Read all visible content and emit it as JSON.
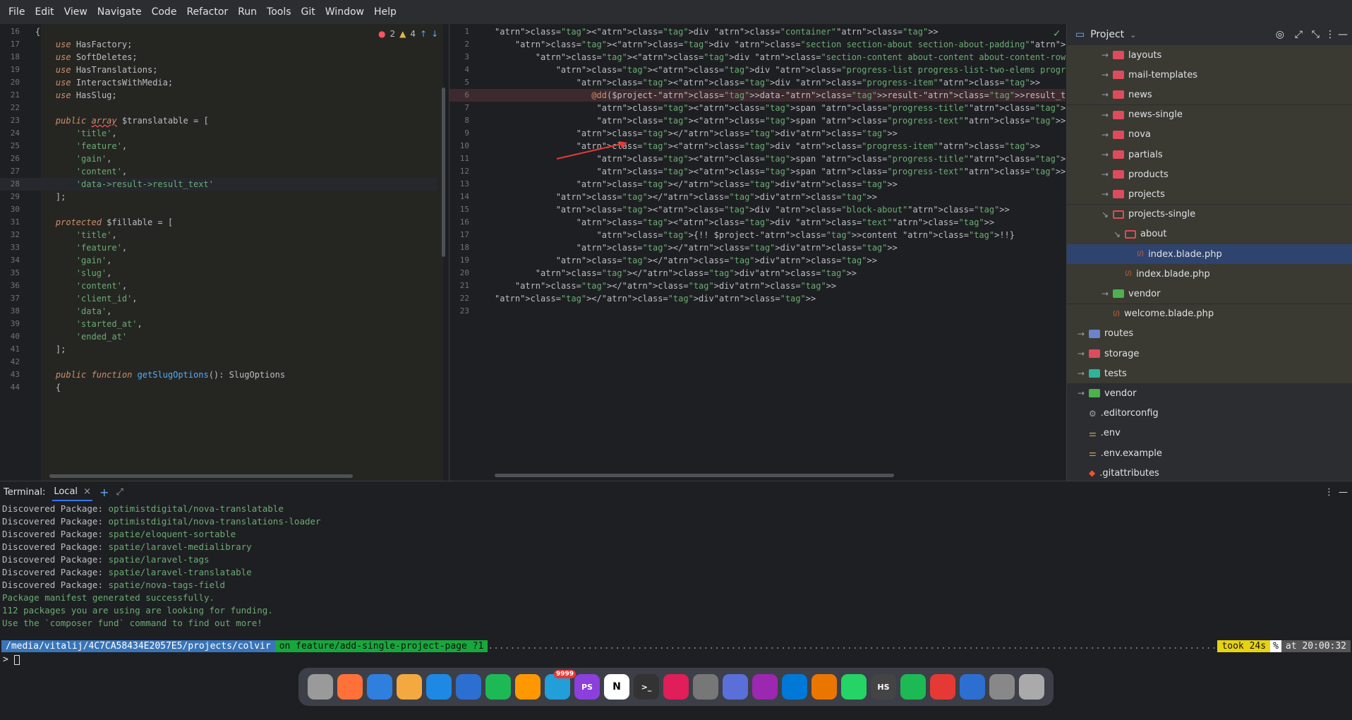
{
  "menu": [
    "File",
    "Edit",
    "View",
    "Navigate",
    "Code",
    "Refactor",
    "Run",
    "Tools",
    "Git",
    "Window",
    "Help"
  ],
  "left_editor": {
    "inspection": {
      "errors": "2",
      "warnings": "4"
    },
    "lines": [
      {
        "n": "16",
        "t": "{"
      },
      {
        "n": "17",
        "t": "    use HasFactory;"
      },
      {
        "n": "18",
        "t": "    use SoftDeletes;"
      },
      {
        "n": "19",
        "t": "    use HasTranslations;"
      },
      {
        "n": "20",
        "t": "    use InteractsWithMedia;"
      },
      {
        "n": "21",
        "t": "    use HasSlug;"
      },
      {
        "n": "22",
        "t": ""
      },
      {
        "n": "23",
        "t": "    public array $translatable = ["
      },
      {
        "n": "24",
        "t": "        'title',"
      },
      {
        "n": "25",
        "t": "        'feature',"
      },
      {
        "n": "26",
        "t": "        'gain',"
      },
      {
        "n": "27",
        "t": "        'content',"
      },
      {
        "n": "28",
        "t": "        'data->result->result_text'"
      },
      {
        "n": "29",
        "t": "    ];"
      },
      {
        "n": "30",
        "t": ""
      },
      {
        "n": "31",
        "t": "    protected $fillable = ["
      },
      {
        "n": "32",
        "t": "        'title',"
      },
      {
        "n": "33",
        "t": "        'feature',"
      },
      {
        "n": "34",
        "t": "        'gain',"
      },
      {
        "n": "35",
        "t": "        'slug',"
      },
      {
        "n": "36",
        "t": "        'content',"
      },
      {
        "n": "37",
        "t": "        'client_id',"
      },
      {
        "n": "38",
        "t": "        'data',"
      },
      {
        "n": "39",
        "t": "        'started_at',"
      },
      {
        "n": "40",
        "t": "        'ended_at'"
      },
      {
        "n": "41",
        "t": "    ];"
      },
      {
        "n": "42",
        "t": ""
      },
      {
        "n": "43",
        "t": "    public function getSlugOptions(): SlugOptions"
      },
      {
        "n": "44",
        "t": "    {"
      }
    ]
  },
  "right_editor": {
    "lines": [
      {
        "n": "1",
        "t": "<div class=\"container\">"
      },
      {
        "n": "2",
        "t": "    <div class=\"section section-about section-about-padding\">"
      },
      {
        "n": "3",
        "t": "        <div class=\"section-content about-content about-content-row\">"
      },
      {
        "n": "4",
        "t": "            <div class=\"progress-list progress-list-two-elems progress-list-mb\">"
      },
      {
        "n": "5",
        "t": "                <div class=\"progress-item\">"
      },
      {
        "n": "6",
        "t": "                   @dd($project->data->result->result_text)"
      },
      {
        "n": "7",
        "t": "                    <span class=\"progress-title\">{{ $project->data['about_page']['year_foundation'] }"
      },
      {
        "n": "8",
        "t": "                    <span class=\"progress-text\">{{ $project->data['about_page']['text_foundation'] }}"
      },
      {
        "n": "9",
        "t": "                </div>"
      },
      {
        "n": "10",
        "t": "                <div class=\"progress-item\">"
      },
      {
        "n": "11",
        "t": "                    <span class=\"progress-title\">{{ $project->data['about_page']['year_cooperation']"
      },
      {
        "n": "12",
        "t": "                    <span class=\"progress-text\">{{ $project->data['about_page']['text_cooperation'] }"
      },
      {
        "n": "13",
        "t": "                </div>"
      },
      {
        "n": "14",
        "t": "            </div>"
      },
      {
        "n": "15",
        "t": "            <div class=\"block-about\">"
      },
      {
        "n": "16",
        "t": "                <div class=\"text\">"
      },
      {
        "n": "17",
        "t": "                    {!! $project->content !!}"
      },
      {
        "n": "18",
        "t": "                </div>"
      },
      {
        "n": "19",
        "t": "            </div>"
      },
      {
        "n": "20",
        "t": "        </div>"
      },
      {
        "n": "21",
        "t": "    </div>"
      },
      {
        "n": "22",
        "t": "</div>"
      },
      {
        "n": "23",
        "t": ""
      }
    ]
  },
  "project": {
    "title": "Project",
    "items": [
      {
        "label": "layouts",
        "depth": 3,
        "type": "folder",
        "state": "closed"
      },
      {
        "label": "mail-templates",
        "depth": 3,
        "type": "folder",
        "state": "closed"
      },
      {
        "label": "news",
        "depth": 3,
        "type": "folder",
        "state": "closed"
      },
      {
        "label": "news-single",
        "depth": 3,
        "type": "folder",
        "state": "closed"
      },
      {
        "label": "nova",
        "depth": 3,
        "type": "folder",
        "state": "closed"
      },
      {
        "label": "partials",
        "depth": 3,
        "type": "folder",
        "state": "closed"
      },
      {
        "label": "products",
        "depth": 3,
        "type": "folder",
        "state": "closed"
      },
      {
        "label": "projects",
        "depth": 3,
        "type": "folder",
        "state": "closed"
      },
      {
        "label": "projects-single",
        "depth": 3,
        "type": "folder",
        "state": "open"
      },
      {
        "label": "about",
        "depth": 4,
        "type": "folder",
        "state": "open"
      },
      {
        "label": "index.blade.php",
        "depth": 5,
        "type": "file",
        "state": "selected"
      },
      {
        "label": "index.blade.php",
        "depth": 4,
        "type": "file",
        "state": ""
      },
      {
        "label": "vendor",
        "depth": 3,
        "type": "folder-green",
        "state": "closed"
      },
      {
        "label": "welcome.blade.php",
        "depth": 3,
        "type": "file",
        "state": ""
      },
      {
        "label": "routes",
        "depth": 1,
        "type": "folder-blue",
        "state": "closed"
      },
      {
        "label": "storage",
        "depth": 1,
        "type": "folder",
        "state": "closed"
      },
      {
        "label": "tests",
        "depth": 1,
        "type": "folder-teal",
        "state": "closed"
      },
      {
        "label": "vendor",
        "depth": 1,
        "type": "folder-green",
        "state": "closed"
      },
      {
        "label": ".editorconfig",
        "depth": 1,
        "type": "config",
        "state": ""
      },
      {
        "label": ".env",
        "depth": 1,
        "type": "env",
        "state": ""
      },
      {
        "label": ".env.example",
        "depth": 1,
        "type": "env",
        "state": ""
      },
      {
        "label": ".gitattributes",
        "depth": 1,
        "type": "git",
        "state": ""
      }
    ]
  },
  "terminal": {
    "label": "Terminal:",
    "tab": "Local",
    "lines": [
      {
        "p": "Discovered Package: ",
        "v": "optimistdigital/nova-translatable"
      },
      {
        "p": "Discovered Package: ",
        "v": "optimistdigital/nova-translations-loader"
      },
      {
        "p": "Discovered Package: ",
        "v": "spatie/eloquent-sortable"
      },
      {
        "p": "Discovered Package: ",
        "v": "spatie/laravel-medialibrary"
      },
      {
        "p": "Discovered Package: ",
        "v": "spatie/laravel-tags"
      },
      {
        "p": "Discovered Package: ",
        "v": "spatie/laravel-translatable"
      },
      {
        "p": "Discovered Package: ",
        "v": "spatie/nova-tags-field"
      },
      {
        "p": "",
        "v": "Package manifest generated successfully."
      },
      {
        "p": "",
        "v": "112 packages you are using are looking for funding."
      },
      {
        "p": "",
        "v": "Use the `composer fund` command to find out more!"
      }
    ],
    "path": "/media/vitalij/4C7CA58434E2057E5/projects/colvir",
    "branch": "on feature/add-single-project-page ?1",
    "took": "took 24s",
    "percent": "%",
    "time": "at 20:00:32",
    "prompt": ">"
  },
  "dock": {
    "badge": "9999",
    "apps": [
      "launchpad",
      "firefox",
      "finder",
      "photos",
      "app-store",
      "thunderbird",
      "spotify",
      "sublime",
      "telegram",
      "phpstorm",
      "notion",
      "terminal",
      "slack",
      "settings",
      "system-prefs",
      "podcasts",
      "vscode",
      "blender",
      "whatsapp",
      "hs",
      "spotify-green",
      "datagrip",
      "thunderbird-2",
      "drive",
      "trash"
    ]
  }
}
